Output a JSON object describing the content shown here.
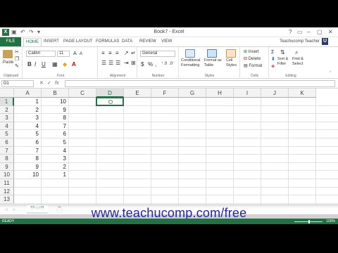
{
  "window": {
    "title": "Book7 - Excel",
    "qat_icons": [
      "save-icon",
      "undo-icon",
      "redo-icon",
      "customize-qat-icon"
    ],
    "controls": [
      "?",
      "▭",
      "–",
      "▢",
      "✕"
    ]
  },
  "ribbon_tabs": [
    "FILE",
    "HOME",
    "INSERT",
    "PAGE LAYOUT",
    "FORMULAS",
    "DATA",
    "REVIEW",
    "VIEW"
  ],
  "user": {
    "name": "Teachucomp Teacher",
    "avatar_letter": "U"
  },
  "ribbon": {
    "clipboard": {
      "paste": "Paste",
      "label": "Clipboard"
    },
    "font": {
      "name": "Calibri",
      "size": "11",
      "bold": "B",
      "italic": "I",
      "underline": "U",
      "grow": "A",
      "shrink": "A",
      "label": "Font"
    },
    "alignment": {
      "label": "Alignment"
    },
    "number": {
      "format": "General",
      "currency": "$",
      "percent": "%",
      "comma": ",",
      "label": "Number"
    },
    "styles": {
      "conditional": [
        "Conditional",
        "Formatting"
      ],
      "format_table": [
        "Format as",
        "Table"
      ],
      "cell_styles": [
        "Cell",
        "Styles"
      ],
      "label": "Styles"
    },
    "cells": {
      "insert": "Insert",
      "delete": "Delete",
      "format": "Format",
      "label": "Cells"
    },
    "editing": {
      "sort": [
        "Sort &",
        "Filter"
      ],
      "find": [
        "Find &",
        "Select"
      ],
      "label": "Editing"
    }
  },
  "formula_bar": {
    "name_box": "D1",
    "cancel": "✕",
    "enter": "✓",
    "fx": "fx",
    "value": ""
  },
  "columns": [
    "A",
    "B",
    "C",
    "D",
    "E",
    "F",
    "G",
    "H",
    "I",
    "J",
    "K"
  ],
  "rows": [
    "1",
    "2",
    "3",
    "4",
    "5",
    "6",
    "7",
    "8",
    "9",
    "10",
    "11",
    "12",
    "13"
  ],
  "cells": {
    "A": [
      "1",
      "2",
      "3",
      "4",
      "5",
      "6",
      "7",
      "8",
      "9",
      "10"
    ],
    "B": [
      "10",
      "9",
      "8",
      "7",
      "6",
      "5",
      "4",
      "3",
      "2",
      "1"
    ]
  },
  "active_cell": "D1",
  "sheet_tabs": [
    "Sheet1"
  ],
  "status": {
    "text": "READY",
    "zoom": "100%"
  },
  "watermark": "www.teachucomp.com/free",
  "colors": {
    "excel_green": "#217346",
    "watermark_blue": "#2323a8"
  }
}
